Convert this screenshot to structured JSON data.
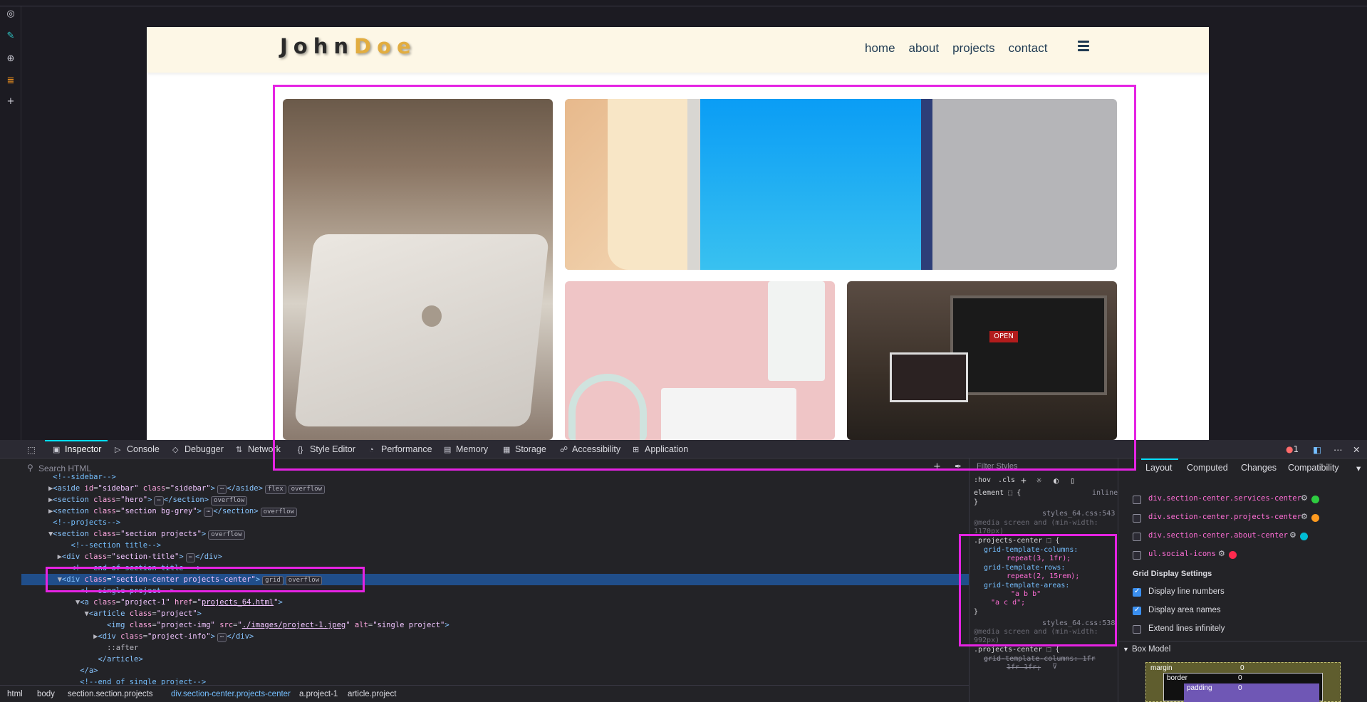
{
  "browser": {
    "left_rail_icons": [
      "globe-icon",
      "pen-icon",
      "globe-active-icon",
      "stack-icon",
      "plus-icon"
    ]
  },
  "site": {
    "logo_part1": "John",
    "logo_part2": "Doe",
    "nav": [
      "home",
      "about",
      "projects",
      "contact"
    ],
    "brand_color": "#e2ad40",
    "nav_color": "#1f3a52",
    "overlay_color": "#e523e3",
    "open_sign": "OPEN"
  },
  "devtools": {
    "tabs": [
      "Inspector",
      "Console",
      "Debugger",
      "Network",
      "Style Editor",
      "Performance",
      "Memory",
      "Storage",
      "Accessibility",
      "Application"
    ],
    "active_tab": "Inspector",
    "error_count": "1",
    "search_placeholder": "Search HTML",
    "filter_placeholder": "Filter Styles",
    "breadcrumb": [
      "html",
      "body",
      "section.section.projects",
      "div.section-center.projects-center",
      "a.project-1",
      "article.project"
    ],
    "rules_toolbar": [
      ":hov",
      ".cls"
    ],
    "rules": {
      "element_selector": "element",
      "element_source": "inline",
      "rule1_source": "styles_64.css:543",
      "rule1_media": "@media screen and (min-width:",
      "rule1_media2": "1170px)",
      "rule1_selector": ".projects-center",
      "rule1_props": [
        {
          "name": "grid-template-columns:",
          "value": "repeat(3, 1fr);"
        },
        {
          "name": "grid-template-rows:",
          "value": "repeat(2, 15rem);"
        },
        {
          "name": "grid-template-areas:",
          "value": "\"a b b\""
        },
        {
          "name": "",
          "value": "\"a c d\";"
        }
      ],
      "rule2_source": "styles_64.css:538",
      "rule2_media": "@media screen and (min-width:",
      "rule2_media2": "992px)",
      "rule2_selector": ".projects-center",
      "rule2_prop": "grid-template-columns: 1fr",
      "rule2_prop2": "1fr 1fr;"
    },
    "layout_tabs": [
      "Layout",
      "Computed",
      "Changes",
      "Compatibility"
    ],
    "grid_items": [
      {
        "label": "div.section-center.services-center",
        "color": "#2ecc40"
      },
      {
        "label": "div.section-center.projects-center",
        "color": "#ff9a1f"
      },
      {
        "label": "div.section-center.about-center",
        "color": "#00bcd4"
      },
      {
        "label": "ul.social-icons",
        "color": "#ff2a4e"
      }
    ],
    "grid_settings_title": "Grid Display Settings",
    "grid_settings": [
      {
        "label": "Display line numbers",
        "checked": true
      },
      {
        "label": "Display area names",
        "checked": true
      },
      {
        "label": "Extend lines infinitely",
        "checked": false
      }
    ],
    "box_model_title": "Box Model",
    "box_model": {
      "margin_label": "margin",
      "margin": "0",
      "border_label": "border",
      "border": "0",
      "padding_label": "padding",
      "padding": "0"
    }
  },
  "markup_lines": [
    {
      "indent": 3,
      "text": "<!--sidebar-->",
      "type": "comment"
    },
    {
      "indent": 3,
      "tri": "▶",
      "tag": "aside",
      "attrs": [
        [
          "id",
          "sidebar"
        ],
        [
          "class",
          "sidebar"
        ]
      ],
      "close": "aside",
      "badges": [
        "flex",
        "overflow"
      ]
    },
    {
      "indent": 3,
      "tri": "▶",
      "tag": "section",
      "attrs": [
        [
          "class",
          "hero"
        ]
      ],
      "close": "section",
      "badges": [
        "overflow"
      ]
    },
    {
      "indent": 3,
      "tri": "▶",
      "tag": "section",
      "attrs": [
        [
          "class",
          "section bg-grey"
        ]
      ],
      "close": "section",
      "badges": [
        "overflow"
      ]
    },
    {
      "indent": 3,
      "text": "<!--projects-->",
      "type": "comment"
    },
    {
      "indent": 3,
      "tri": "▼",
      "tag": "section",
      "attrs": [
        [
          "class",
          "section projects"
        ]
      ],
      "badges": [
        "overflow"
      ]
    },
    {
      "indent": 5,
      "text": "<!--section title-->",
      "type": "comment"
    },
    {
      "indent": 4,
      "tri": "▶",
      "tag": "div",
      "attrs": [
        [
          "class",
          "section-title"
        ]
      ],
      "close": "div"
    },
    {
      "indent": 5,
      "text": "<!-- end of section title -->",
      "type": "comment"
    },
    {
      "indent": 4,
      "tri": "▼",
      "tag": "div",
      "attrs": [
        [
          "class",
          "section-center projects-center"
        ]
      ],
      "badges": [
        "grid",
        "overflow"
      ],
      "selected": true
    },
    {
      "indent": 6,
      "text": "<!--single project-->",
      "type": "comment"
    },
    {
      "indent": 6,
      "tri": "▼",
      "tag": "a",
      "attrs": [
        [
          "class",
          "project-1"
        ],
        [
          "href",
          "projects_64.html"
        ]
      ]
    },
    {
      "indent": 7,
      "tri": "▼",
      "tag": "article",
      "attrs": [
        [
          "class",
          "project"
        ]
      ]
    },
    {
      "indent": 9,
      "tag": "img",
      "attrs": [
        [
          "class",
          "project-img"
        ],
        [
          "src",
          "./images/project-1.jpeg"
        ],
        [
          "alt",
          "single project"
        ]
      ]
    },
    {
      "indent": 8,
      "tri": "▶",
      "tag": "div",
      "attrs": [
        [
          "class",
          "project-info"
        ]
      ],
      "close": "div"
    },
    {
      "indent": 9,
      "text": "::after",
      "type": "pseudo"
    },
    {
      "indent": 8,
      "text": "</article>",
      "type": "closetag"
    },
    {
      "indent": 6,
      "text": "</a>",
      "type": "closetag"
    },
    {
      "indent": 6,
      "text": "<!--end of single project-->",
      "type": "comment"
    }
  ]
}
